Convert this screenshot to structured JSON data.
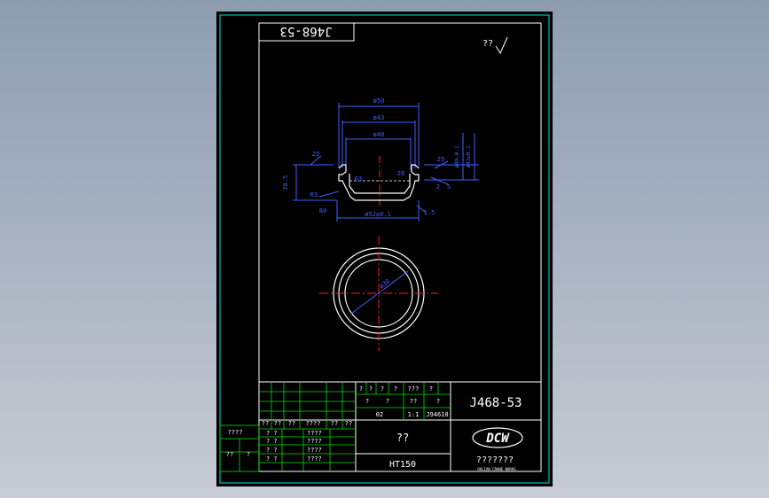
{
  "drawing": {
    "top_tab_code": "J468-53",
    "top_right_mark": "??",
    "dims": {
      "d_top": "ø50",
      "d_mid": "ø43",
      "d_inner": "ø40",
      "left_height": "28.5",
      "left_ra": "25",
      "right_ra": "25",
      "right_v1": "5",
      "right_v2": "2",
      "bot_dim": "ø52±0.1",
      "bot_r": "1.5",
      "ann_63": "63",
      "ann_80": "80",
      "ann_20": "20",
      "ann_r3": "R3",
      "right_text1": "ø49-0.1",
      "right_text2": "ø43±0.1",
      "circle_dim": "ø38"
    }
  },
  "title_block": {
    "part_code": "J468-53",
    "part_name": "??",
    "material": "HT150",
    "company": "???????",
    "logo": "DCW",
    "logo_sub": "DALIAN CRANE WORKS",
    "mid_row1": [
      "?",
      "?",
      "?",
      "?",
      "???",
      "?"
    ],
    "mid_row2": [
      "?",
      "?",
      "??",
      "?"
    ],
    "mid_row3": [
      "02",
      "1:1",
      "J94610"
    ],
    "left_headers": [
      "??",
      "??",
      "??",
      "????",
      "??",
      "??"
    ],
    "sig_rows": [
      {
        "a": "? ?",
        "b": "????"
      },
      {
        "a": "? ?",
        "b": "????"
      },
      {
        "a": "? ?",
        "b": "????"
      },
      {
        "a": "? ?",
        "b": "????"
      }
    ],
    "side_labels": [
      "????",
      "??",
      "?"
    ]
  }
}
